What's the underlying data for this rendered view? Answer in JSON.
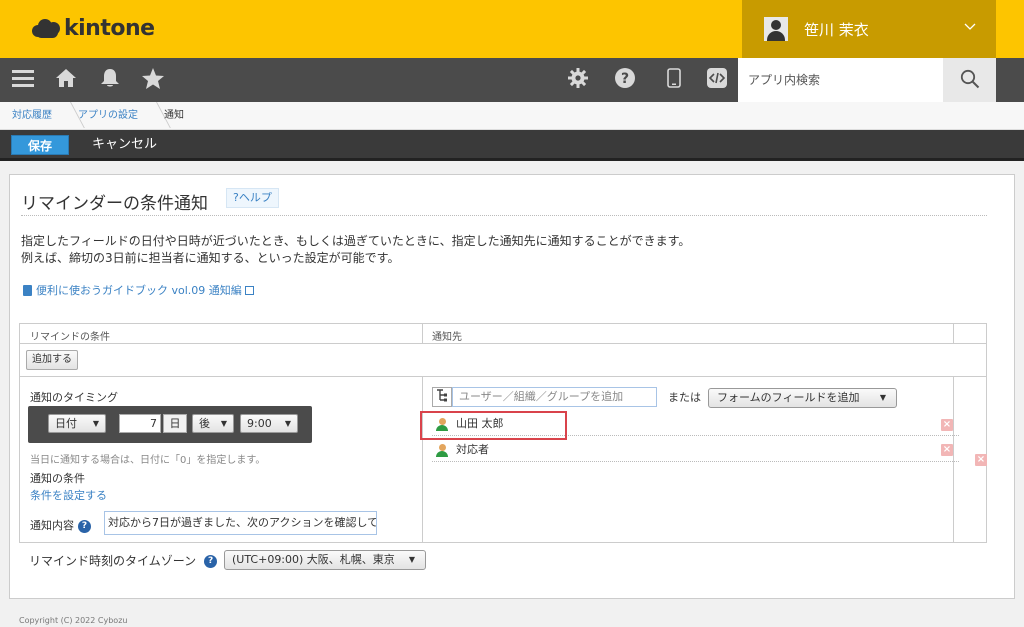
{
  "header": {
    "logo_text": "kintone",
    "user_name": "笹川 茉衣",
    "brand_color": "#fdc500"
  },
  "nav": {
    "icons": [
      "menu-icon",
      "home-icon",
      "bell-icon",
      "star-icon",
      "gear-icon",
      "question-icon",
      "mobile-icon",
      "code-icon"
    ],
    "search_placeholder": "アプリ内検索"
  },
  "breadcrumb": {
    "items": [
      "対応履歴",
      "アプリの設定",
      "通知"
    ]
  },
  "toolbar": {
    "save_label": "保存",
    "cancel_label": "キャンセル"
  },
  "page": {
    "title": "リマインダーの条件通知",
    "help_label": "?ヘルプ",
    "desc_line1": "指定したフィールドの日付や日時が近づいたとき、もしくは過ぎていたときに、指定した通知先に通知することができます。",
    "desc_line2": "例えば、締切の3日前に担当者に通知する、といった設定が可能です。",
    "guide_link": "便利に使おうガイドブック vol.09 通知編"
  },
  "table": {
    "header_condition": "リマインドの条件",
    "header_destination": "通知先",
    "add_button": "追加する",
    "timing_label": "通知のタイミング",
    "date_field": "日付",
    "days_value": "7",
    "days_unit": "日",
    "before_after": "後",
    "time_value": "9:00",
    "hint": "当日に通知する場合は、日付に「0」を指定します。",
    "condition_label": "通知の条件",
    "condition_link": "条件を設定する",
    "content_label": "通知内容",
    "content_value": "対応から7日が過ぎました、次のアクションを確認して",
    "user_input_placeholder": "ユーザー／組織／グループを追加",
    "or_text": "または",
    "field_dropdown": "フォームのフィールドを追加",
    "recipients": [
      "山田 太郎",
      "対応者"
    ],
    "highlight_color": "#d9434b"
  },
  "timezone": {
    "label": "リマインド時刻のタイムゾーン",
    "value": "(UTC+09:00) 大阪、札幌、東京"
  },
  "footer": {
    "copyright": "Copyright (C) 2022 Cybozu"
  }
}
